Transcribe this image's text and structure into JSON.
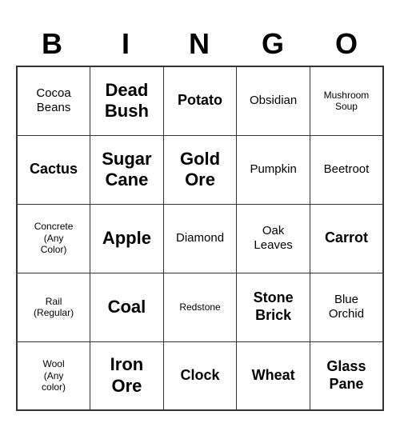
{
  "header": {
    "letters": [
      "B",
      "I",
      "N",
      "G",
      "O"
    ]
  },
  "grid": [
    [
      {
        "text": "Cocoa\nBeans",
        "size": "md"
      },
      {
        "text": "Dead\nBush",
        "size": "xl"
      },
      {
        "text": "Potato",
        "size": "lg"
      },
      {
        "text": "Obsidian",
        "size": "md"
      },
      {
        "text": "Mushroom\nSoup",
        "size": "sm"
      }
    ],
    [
      {
        "text": "Cactus",
        "size": "lg"
      },
      {
        "text": "Sugar\nCane",
        "size": "xl"
      },
      {
        "text": "Gold\nOre",
        "size": "xl"
      },
      {
        "text": "Pumpkin",
        "size": "md"
      },
      {
        "text": "Beetroot",
        "size": "md"
      }
    ],
    [
      {
        "text": "Concrete\n(Any\nColor)",
        "size": "sm"
      },
      {
        "text": "Apple",
        "size": "xl"
      },
      {
        "text": "Diamond",
        "size": "md"
      },
      {
        "text": "Oak\nLeaves",
        "size": "md"
      },
      {
        "text": "Carrot",
        "size": "lg"
      }
    ],
    [
      {
        "text": "Rail\n(Regular)",
        "size": "sm"
      },
      {
        "text": "Coal",
        "size": "xl"
      },
      {
        "text": "Redstone",
        "size": "sm"
      },
      {
        "text": "Stone\nBrick",
        "size": "lg"
      },
      {
        "text": "Blue\nOrchid",
        "size": "md"
      }
    ],
    [
      {
        "text": "Wool\n(Any\ncolor)",
        "size": "sm"
      },
      {
        "text": "Iron\nOre",
        "size": "xl"
      },
      {
        "text": "Clock",
        "size": "lg"
      },
      {
        "text": "Wheat",
        "size": "lg"
      },
      {
        "text": "Glass\nPane",
        "size": "lg"
      }
    ]
  ]
}
